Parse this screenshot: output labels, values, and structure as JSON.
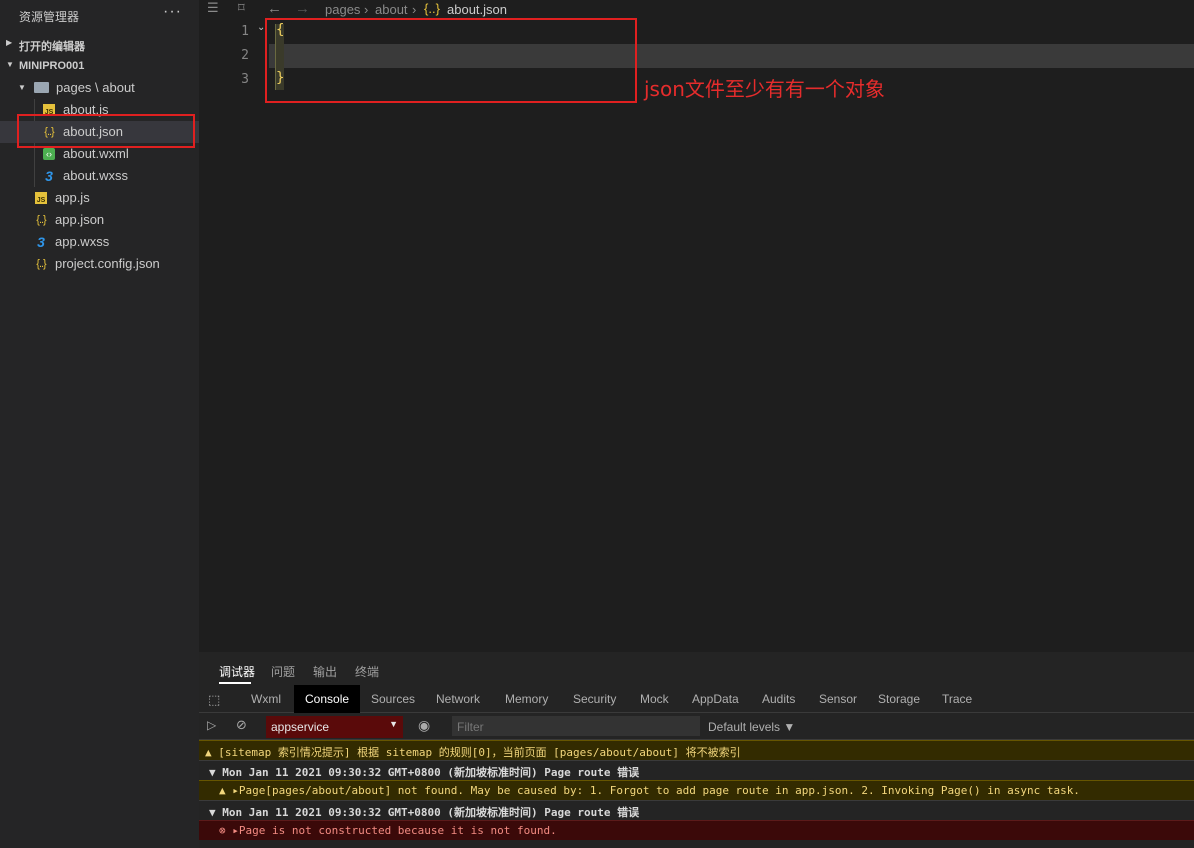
{
  "sidebar": {
    "title": "资源管理器",
    "more": "···",
    "open_editors": "打开的编辑器",
    "project": "MINIPRO001",
    "folder": "pages \\ about",
    "files_inner": [
      "about.js",
      "about.json",
      "about.wxml",
      "about.wxss"
    ],
    "files_root": [
      "app.js",
      "app.json",
      "app.wxss",
      "project.config.json"
    ],
    "selected": "about.json"
  },
  "editor": {
    "breadcrumb": [
      "pages",
      "about",
      "about.json"
    ],
    "line_numbers": [
      "1",
      "2",
      "3"
    ],
    "code_lines": [
      "{",
      "",
      "}"
    ],
    "annotation": "json文件至少有有一个对象"
  },
  "devtools": {
    "top_tabs": [
      "调试器",
      "问题",
      "输出",
      "终端"
    ],
    "tabs": [
      "Wxml",
      "Console",
      "Sources",
      "Network",
      "Memory",
      "Security",
      "Mock",
      "AppData",
      "Audits",
      "Sensor",
      "Storage",
      "Trace"
    ],
    "active_tab": "Console",
    "context": "appservice",
    "filter_placeholder": "Filter",
    "levels": "Default levels ▼",
    "messages": [
      "▲ [sitemap 索引情况提示] 根据 sitemap 的规则[0]，当前页面 [pages/about/about] 将不被索引",
      "▼ Mon Jan 11 2021 09:30:32 GMT+0800 (新加坡标准时间) Page route 错误",
      "▲ ▸Page[pages/about/about] not found. May be caused by: 1. Forgot to add page route in app.json. 2. Invoking Page() in async task.",
      "▼ Mon Jan 11 2021 09:30:32 GMT+0800 (新加坡标准时间) Page route 错误",
      "⊗ ▸Page is not constructed because it is not found."
    ]
  }
}
